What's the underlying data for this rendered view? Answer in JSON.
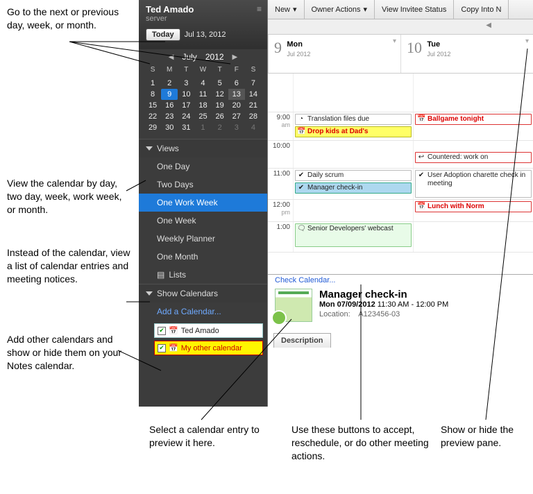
{
  "user": {
    "name": "Ted Amado",
    "role": "server"
  },
  "today": {
    "button": "Today",
    "date": "Jul 13, 2012"
  },
  "miniCal": {
    "month": "July",
    "year": "2012",
    "dow": [
      "S",
      "M",
      "T",
      "W",
      "T",
      "F",
      "S"
    ],
    "rows": [
      [
        {
          "n": "1"
        },
        {
          "n": "2"
        },
        {
          "n": "3"
        },
        {
          "n": "4"
        },
        {
          "n": "5"
        },
        {
          "n": "6"
        },
        {
          "n": "7"
        }
      ],
      [
        {
          "n": "8"
        },
        {
          "n": "9",
          "sel": true
        },
        {
          "n": "10"
        },
        {
          "n": "11"
        },
        {
          "n": "12"
        },
        {
          "n": "13",
          "hl": true
        },
        {
          "n": "14"
        }
      ],
      [
        {
          "n": "15"
        },
        {
          "n": "16"
        },
        {
          "n": "17"
        },
        {
          "n": "18"
        },
        {
          "n": "19"
        },
        {
          "n": "20"
        },
        {
          "n": "21"
        }
      ],
      [
        {
          "n": "22"
        },
        {
          "n": "23"
        },
        {
          "n": "24"
        },
        {
          "n": "25"
        },
        {
          "n": "26"
        },
        {
          "n": "27"
        },
        {
          "n": "28"
        }
      ],
      [
        {
          "n": "29"
        },
        {
          "n": "30"
        },
        {
          "n": "31"
        },
        {
          "n": "1",
          "dim": true
        },
        {
          "n": "2",
          "dim": true
        },
        {
          "n": "3",
          "dim": true
        },
        {
          "n": "4",
          "dim": true
        }
      ]
    ]
  },
  "sections": {
    "views": {
      "title": "Views",
      "items": [
        "One Day",
        "Two Days",
        "One Work Week",
        "One Week",
        "Weekly Planner",
        "One Month"
      ],
      "selected": 2,
      "lists": "Lists"
    },
    "showCal": {
      "title": "Show Calendars",
      "add": "Add a Calendar...",
      "cals": [
        "Ted Amado",
        "My other calendar"
      ]
    }
  },
  "toolbar": [
    "New",
    "Owner Actions",
    "View Invitee Status",
    "Copy Into N"
  ],
  "days": [
    {
      "num": "9",
      "dow": "Mon",
      "sub": "Jul 2012"
    },
    {
      "num": "10",
      "dow": "Tue",
      "sub": "Jul 2012"
    }
  ],
  "hours": [
    "",
    "9:00",
    "",
    "10:00",
    "11:00",
    "12:00",
    "1:00"
  ],
  "hoursAm": [
    "",
    "am",
    "",
    "",
    "",
    "pm",
    ""
  ],
  "events": {
    "mon9a": {
      "label": "Translation files due",
      "cls": "evt-white",
      "icn": "◔"
    },
    "mon9b": {
      "label": "Drop kids at Dad's",
      "cls": "evt-yellow",
      "icn": "📅"
    },
    "mon11a": {
      "label": "Daily scrum",
      "cls": "evt-white",
      "icn": "✔"
    },
    "mon11b": {
      "label": "Manager check-in",
      "cls": "evt-sel",
      "icn": "✔"
    },
    "mon1": {
      "label": "Senior Developers' webcast",
      "cls": "evt-green",
      "icn": "🗨"
    },
    "tue9": {
      "label": "Ballgame tonight",
      "cls": "evt-red",
      "icn": "📅"
    },
    "tue10": {
      "label": "Countered: work on",
      "cls": "evt-counter",
      "icn": "↩"
    },
    "tue11": {
      "label": "User Adoption charette check in meeting",
      "cls": "evt-white",
      "icn": "✔"
    },
    "tue12": {
      "label": "Lunch with Norm",
      "cls": "evt-red",
      "icn": "📅"
    }
  },
  "preview": {
    "check": "Check Calendar...",
    "title": "Manager check-in",
    "dateBold": "Mon 07/09/2012",
    "dateRest": " 11:30 AM - 12:00 PM",
    "locationLabel": "Location:",
    "location": "A123456-03",
    "tab": "Description"
  },
  "annotations": {
    "a1": "Go to the next or previous day, week, or month.",
    "a2": "View the calendar by day, two day, week, work week, or month.",
    "a3": "Instead of the calendar, view a list of calendar entries and meeting notices.",
    "a4": "Add other calendars and show or hide them on your Notes calendar.",
    "a5": "Select a calendar entry to preview it here.",
    "a6": "Use these buttons to accept, reschedule, or do other meeting actions.",
    "a7": "Show or hide the preview pane."
  }
}
